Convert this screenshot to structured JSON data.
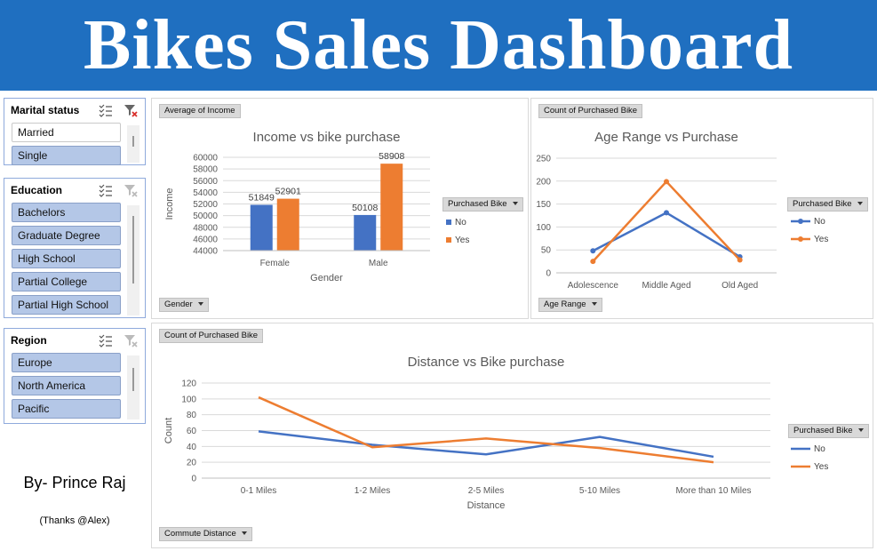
{
  "banner": {
    "title": "Bikes Sales Dashboard"
  },
  "slicers": {
    "marital": {
      "title": "Marital status",
      "items": [
        {
          "label": "Married",
          "selected": false
        },
        {
          "label": "Single",
          "selected": true
        }
      ]
    },
    "education": {
      "title": "Education",
      "items": [
        {
          "label": "Bachelors",
          "selected": true
        },
        {
          "label": "Graduate Degree",
          "selected": true
        },
        {
          "label": "High School",
          "selected": true
        },
        {
          "label": "Partial College",
          "selected": true
        },
        {
          "label": "Partial High School",
          "selected": true
        }
      ]
    },
    "region": {
      "title": "Region",
      "items": [
        {
          "label": "Europe",
          "selected": true
        },
        {
          "label": "North America",
          "selected": true
        },
        {
          "label": "Pacific",
          "selected": true
        }
      ]
    }
  },
  "credits": {
    "author": "By- Prince Raj",
    "thanks": "(Thanks @Alex)"
  },
  "colors": {
    "no": "#4472c4",
    "yes": "#ed7d31",
    "banner": "#1f6fc0",
    "slicer_selected": "#b4c7e7"
  },
  "charts": {
    "income": {
      "value_button": "Average of Income",
      "axis_button": "Gender",
      "legend_button": "Purchased Bike"
    },
    "age": {
      "value_button": "Count of Purchased Bike",
      "axis_button": "Age Range",
      "legend_button": "Purchased Bike"
    },
    "distance": {
      "value_button": "Count of Purchased Bike",
      "axis_button": "Commute Distance",
      "legend_button": "Purchased Bike"
    }
  },
  "chart_data": [
    {
      "type": "bar",
      "title": "Income vs bike purchase",
      "xlabel": "Gender",
      "ylabel": "Income",
      "categories": [
        "Female",
        "Male"
      ],
      "series": [
        {
          "name": "No",
          "values": [
            51849,
            50108
          ]
        },
        {
          "name": "Yes",
          "values": [
            52901,
            58908
          ]
        }
      ],
      "ylim": [
        44000,
        60000
      ],
      "yticks": [
        44000,
        46000,
        48000,
        50000,
        52000,
        54000,
        56000,
        58000,
        60000
      ],
      "data_labels": true,
      "grid": true,
      "legend": "right"
    },
    {
      "type": "line",
      "title": "Age Range vs Purchase",
      "xlabel": "",
      "ylabel": "",
      "categories": [
        "Adolescence",
        "Middle Aged",
        "Old Aged"
      ],
      "series": [
        {
          "name": "No",
          "values": [
            48,
            131,
            35
          ]
        },
        {
          "name": "Yes",
          "values": [
            25,
            199,
            28
          ]
        }
      ],
      "ylim": [
        0,
        250
      ],
      "yticks": [
        0,
        50,
        100,
        150,
        200,
        250
      ],
      "markers": true,
      "grid": true,
      "legend": "right"
    },
    {
      "type": "line",
      "title": "Distance vs Bike purchase",
      "xlabel": "Distance",
      "ylabel": "Count",
      "categories": [
        "0-1 Miles",
        "1-2 Miles",
        "2-5 Miles",
        "5-10 Miles",
        "More than 10 Miles"
      ],
      "series": [
        {
          "name": "No",
          "values": [
            59,
            42,
            30,
            52,
            27
          ]
        },
        {
          "name": "Yes",
          "values": [
            102,
            39,
            50,
            38,
            20
          ]
        }
      ],
      "ylim": [
        0,
        120
      ],
      "yticks": [
        0,
        20,
        40,
        60,
        80,
        100,
        120
      ],
      "markers": false,
      "grid": true,
      "legend": "right"
    }
  ]
}
